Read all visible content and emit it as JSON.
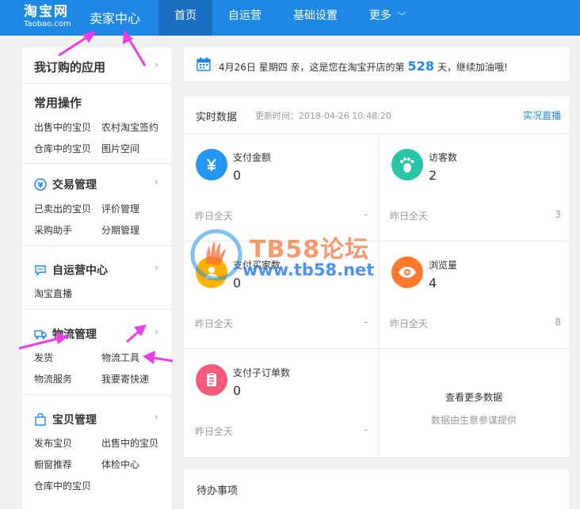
{
  "header": {
    "logo_main": "淘宝网",
    "logo_sub": "Taobao.com",
    "center_title": "卖家中心",
    "nav": [
      {
        "label": "首页"
      },
      {
        "label": "自运营"
      },
      {
        "label": "基础设置"
      },
      {
        "label": "更多"
      }
    ]
  },
  "sidebar": {
    "subscribed_title": "我订购的应用",
    "common_title": "常用操作",
    "common_links": [
      "出售中的宝贝",
      "农村淘宝签约",
      "仓库中的宝贝",
      "图片空间"
    ],
    "sections": [
      {
        "title": "交易管理",
        "icon": "yen-circle-icon",
        "links": [
          "已卖出的宝贝",
          "评价管理",
          "采购助手",
          "分期管理"
        ]
      },
      {
        "title": "自运营中心",
        "icon": "chat-icon",
        "links": [
          "淘宝直播"
        ]
      },
      {
        "title": "物流管理",
        "icon": "truck-icon",
        "links": [
          "发货",
          "物流工具",
          "物流服务",
          "我要寄快递"
        ]
      },
      {
        "title": "宝贝管理",
        "icon": "bag-icon",
        "links": [
          "发布宝贝",
          "出售中的宝贝",
          "橱窗推荐",
          "体检中心",
          "仓库中的宝贝"
        ]
      }
    ]
  },
  "welcome": {
    "prefix": "4月26日 星期四  亲，这是您在淘宝开店的第",
    "days": "528",
    "suffix": "天，继续加油哦!"
  },
  "realtime": {
    "title": "实时数据",
    "update": "更新时间：2018-04-26 10:48:20",
    "live_link": "实况直播",
    "metrics": [
      {
        "label": "支付金额",
        "value": "0",
        "foot": "昨日全天",
        "foot_value": "-",
        "color": "#2196f3",
        "icon": "yen-icon"
      },
      {
        "label": "访客数",
        "value": "2",
        "foot": "昨日全天",
        "foot_value": "3",
        "color": "#26c6a6",
        "icon": "footprint-icon"
      },
      {
        "label": "支付买家数",
        "value": "0",
        "foot": "昨日全天",
        "foot_value": "-",
        "color": "#ffb300",
        "icon": "buyer-icon"
      },
      {
        "label": "浏览量",
        "value": "4",
        "foot": "昨日全天",
        "foot_value": "8",
        "color": "#ff7a2e",
        "icon": "eye-icon"
      },
      {
        "label": "支付子订单数",
        "value": "0",
        "foot": "昨日全天",
        "foot_value": "-",
        "color": "#f35c7a",
        "icon": "order-icon"
      }
    ],
    "more_title": "查看更多数据",
    "more_sub": "数据由生意参谋提供"
  },
  "todo": {
    "title": "待办事项"
  },
  "watermark": {
    "text1": "TB58论坛",
    "text2": "www.tb58.net"
  },
  "colors": {
    "primary": "#1e88e5",
    "annotation": "#e83de8"
  }
}
